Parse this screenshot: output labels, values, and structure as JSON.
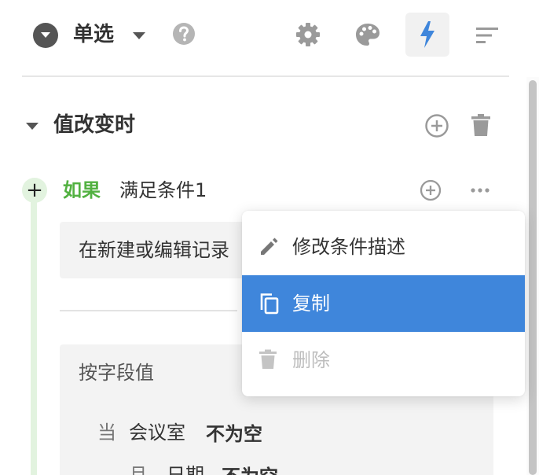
{
  "toolbar": {
    "control_type": "单选",
    "icons": [
      "help-icon",
      "gear-icon",
      "palette-icon",
      "lightning-icon",
      "sort-icon"
    ],
    "active_icon": "lightning-icon",
    "accent_color": "#3f86db"
  },
  "section": {
    "title": "值改变时"
  },
  "condition": {
    "if_label": "如果",
    "name": "满足条件1",
    "description": "在新建或编辑记录",
    "accent_color": "#52b141"
  },
  "field_block": {
    "title": "按字段值",
    "rows": [
      {
        "prefix": "当",
        "field": "会议室",
        "operator": "不为空"
      },
      {
        "prefix": "且",
        "field": "日期",
        "operator": "不为空"
      }
    ]
  },
  "context_menu": {
    "items": [
      {
        "label": "修改条件描述",
        "icon": "pencil-icon",
        "state": "normal"
      },
      {
        "label": "复制",
        "icon": "copy-icon",
        "state": "highlighted"
      },
      {
        "label": "删除",
        "icon": "trash-icon",
        "state": "disabled"
      }
    ]
  }
}
